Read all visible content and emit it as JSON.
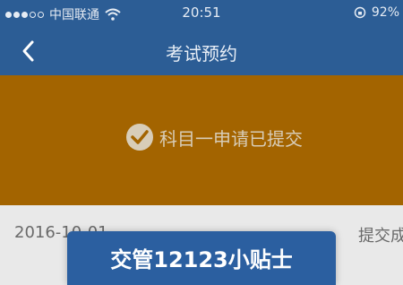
{
  "status_bar": {
    "carrier": "中国联通",
    "time": "20:51",
    "battery": "92%"
  },
  "nav": {
    "title": "考试预约"
  },
  "banner": {
    "message": "科目一申请已提交"
  },
  "row": {
    "date": "2016-10-01",
    "status": "提交成功"
  },
  "dialog": {
    "title": "交管12123小贴士"
  },
  "colors": {
    "nav_bg": "#2c5d95",
    "banner_bg": "#a36400",
    "dialog_bg": "#2b5fa0"
  },
  "icons": [
    "signal-dots-icon",
    "wifi-icon",
    "orientation-lock-icon",
    "back-chevron-icon",
    "check-circle-icon"
  ]
}
